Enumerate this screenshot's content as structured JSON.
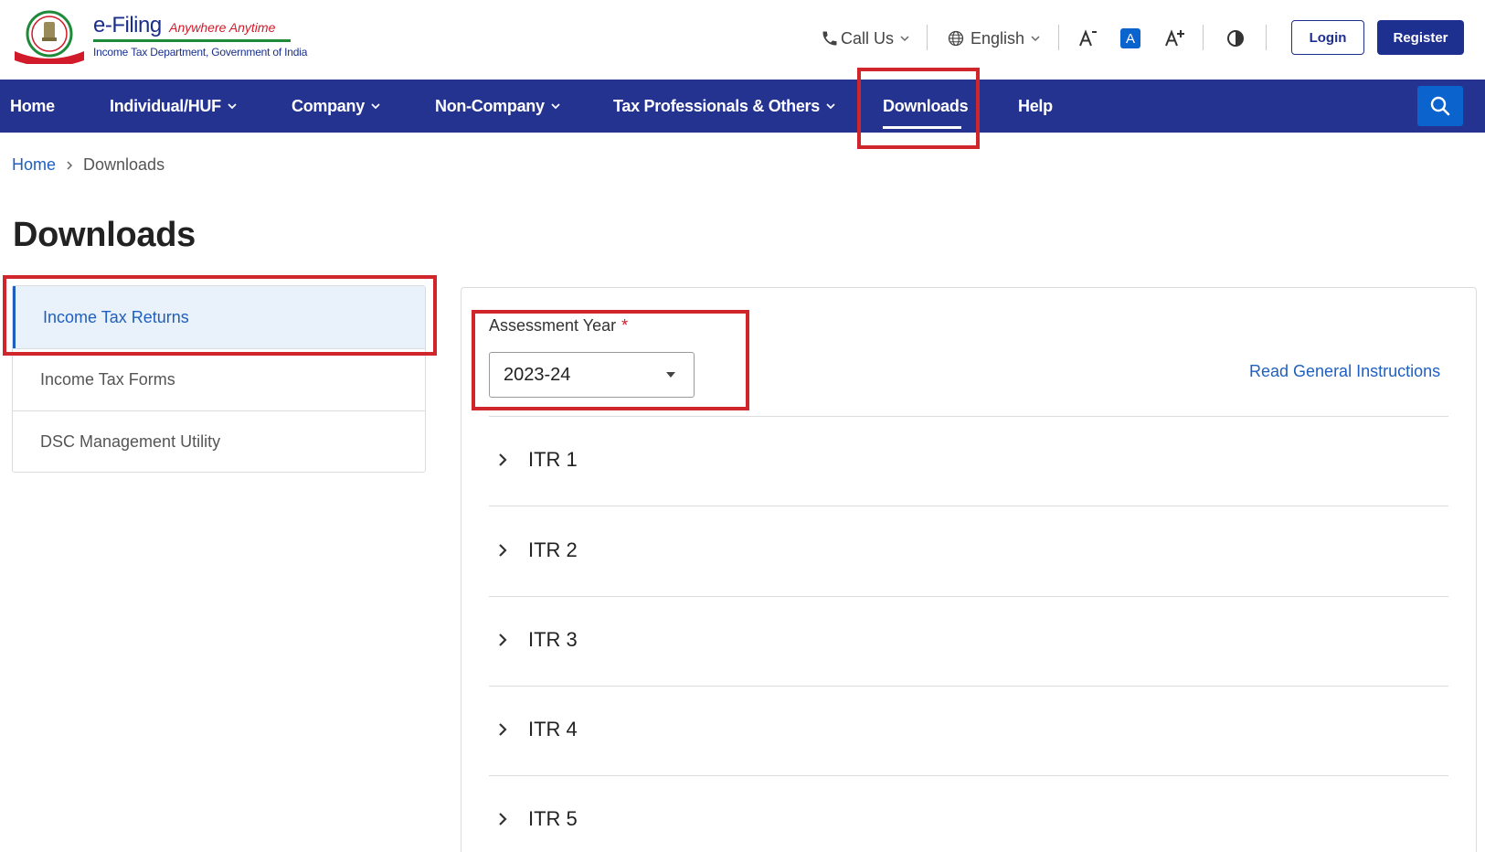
{
  "header": {
    "brand_main": "e-Filing",
    "brand_tagline": "Anywhere Anytime",
    "brand_sub": "Income Tax Department, Government of India",
    "call_us": "Call Us",
    "language": "English",
    "font_normal_label": "A",
    "login": "Login",
    "register": "Register"
  },
  "nav": {
    "items": [
      {
        "label": "Home"
      },
      {
        "label": "Individual/HUF"
      },
      {
        "label": "Company"
      },
      {
        "label": "Non-Company"
      },
      {
        "label": "Tax Professionals & Others"
      },
      {
        "label": "Downloads"
      },
      {
        "label": "Help"
      }
    ],
    "active": "Downloads"
  },
  "breadcrumb": {
    "home": "Home",
    "current": "Downloads"
  },
  "page": {
    "title": "Downloads"
  },
  "sidebar": {
    "items": [
      {
        "label": "Income Tax Returns"
      },
      {
        "label": "Income Tax Forms"
      },
      {
        "label": "DSC Management Utility"
      }
    ]
  },
  "main": {
    "assessment_year_label": "Assessment Year",
    "required_mark": "*",
    "assessment_year_value": "2023-24",
    "read_instructions": "Read General Instructions",
    "accordion": [
      {
        "label": "ITR 1"
      },
      {
        "label": "ITR 2"
      },
      {
        "label": "ITR 3"
      },
      {
        "label": "ITR 4"
      },
      {
        "label": "ITR 5"
      }
    ]
  },
  "colors": {
    "nav_bg": "#23338f",
    "primary_blue": "#1d2f8f",
    "link_blue": "#1f5fbf",
    "search_blue": "#0b63ce",
    "highlight_red": "#d0252b",
    "active_bg": "#e9f1fb"
  }
}
